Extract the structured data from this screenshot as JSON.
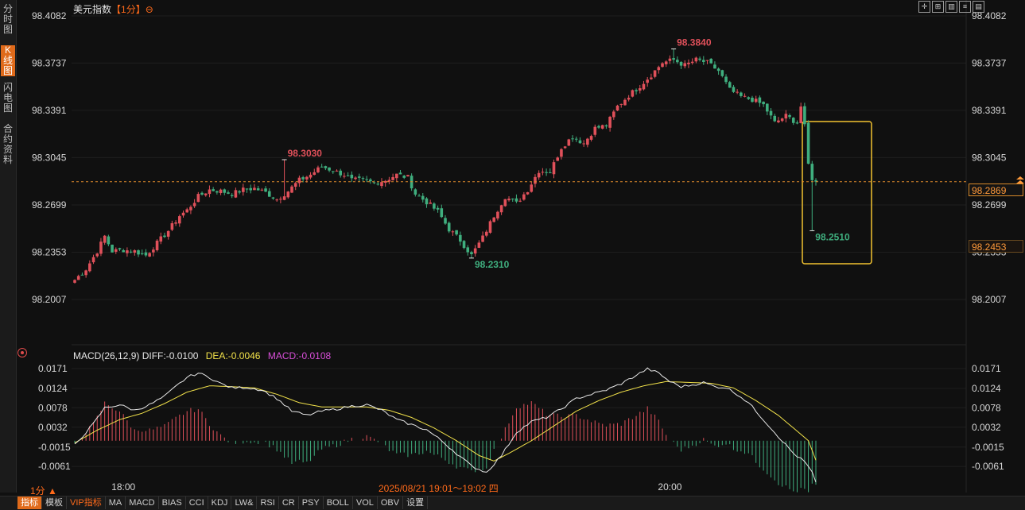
{
  "sidebar": {
    "tabs": [
      {
        "label": "分时图",
        "active": false
      },
      {
        "label": "K线图",
        "active": true
      },
      {
        "label": "闪电图",
        "active": false
      },
      {
        "label": "合约资料",
        "active": false
      }
    ]
  },
  "header": {
    "title": "美元指数",
    "period_label": "【1分】",
    "period_icon": "⊖",
    "toolbar_icons": [
      "grid-icon",
      "expand-icon",
      "bar-icon",
      "settings-icon",
      "layout-icon"
    ]
  },
  "macd_legend": {
    "params": "MACD(26,12,9)",
    "diff": "DIFF:-0.0100",
    "dea": "DEA:-0.0046",
    "macd": "MACD:-0.0108"
  },
  "footer": {
    "period_selector": "1分 ▲",
    "crosshair_time": "2025/08/21 19:01～19:02 四",
    "tabs": [
      {
        "label": "指标",
        "active": true
      },
      {
        "label": "模板"
      },
      {
        "label": "VIP指标",
        "vip": true
      },
      {
        "label": "MA"
      },
      {
        "label": "MACD"
      },
      {
        "label": "BIAS"
      },
      {
        "label": "CCI"
      },
      {
        "label": "KDJ"
      },
      {
        "label": "LW&"
      },
      {
        "label": "RSI"
      },
      {
        "label": "CR"
      },
      {
        "label": "PSY"
      },
      {
        "label": "BOLL"
      },
      {
        "label": "VOL"
      },
      {
        "label": "OBV"
      },
      {
        "label": "设置"
      }
    ]
  },
  "chart_data": [
    {
      "type": "candlestick",
      "title": "美元指数",
      "period": "1分",
      "y_ticks": [
        98.4082,
        98.3737,
        98.3391,
        98.3045,
        98.2699,
        98.2353,
        98.2007
      ],
      "ylim": [
        98.2007,
        98.4082
      ],
      "x_tick_labels": [
        "18:00",
        "20:00"
      ],
      "current_price_label": "98.2869",
      "current_price": 98.2869,
      "low_price_label": "98.2453",
      "annotations": [
        {
          "label": "98.3030",
          "value": 98.303,
          "kind": "local-high"
        },
        {
          "label": "98.3840",
          "value": 98.384,
          "kind": "session-high"
        },
        {
          "label": "98.2310",
          "value": 98.231,
          "kind": "local-low"
        },
        {
          "label": "98.2510",
          "value": 98.251,
          "kind": "recent-low"
        }
      ],
      "highlight_box": {
        "color": "#f2c230",
        "from_bar": 153,
        "to_bar": 163,
        "y_range": [
          98.23,
          98.33
        ]
      },
      "up_color": "#e0505a",
      "down_color": "#3fae7e",
      "close_path": [
        [
          0,
          98.215
        ],
        [
          3,
          98.223
        ],
        [
          6,
          98.236
        ],
        [
          8,
          98.247
        ],
        [
          10,
          98.236
        ],
        [
          13,
          98.237
        ],
        [
          16,
          98.236
        ],
        [
          19,
          98.233
        ],
        [
          22,
          98.242
        ],
        [
          25,
          98.251
        ],
        [
          28,
          98.262
        ],
        [
          30,
          98.266
        ],
        [
          33,
          98.276
        ],
        [
          36,
          98.281
        ],
        [
          39,
          98.28
        ],
        [
          42,
          98.278
        ],
        [
          45,
          98.281
        ],
        [
          48,
          98.282
        ],
        [
          51,
          98.279
        ],
        [
          54,
          98.274
        ],
        [
          57,
          98.28
        ],
        [
          60,
          98.288
        ],
        [
          63,
          98.292
        ],
        [
          66,
          98.298
        ],
        [
          69,
          98.295
        ],
        [
          72,
          98.292
        ],
        [
          74,
          98.288
        ],
        [
          77,
          98.288
        ],
        [
          80,
          98.286
        ],
        [
          83,
          98.288
        ],
        [
          86,
          98.292
        ],
        [
          89,
          98.29
        ],
        [
          91,
          98.278
        ],
        [
          94,
          98.272
        ],
        [
          97,
          98.265
        ],
        [
          100,
          98.252
        ],
        [
          103,
          98.244
        ],
        [
          106,
          98.233
        ],
        [
          109,
          98.246
        ],
        [
          112,
          98.262
        ],
        [
          115,
          98.276
        ],
        [
          118,
          98.271
        ],
        [
          121,
          98.281
        ],
        [
          124,
          98.295
        ],
        [
          127,
          98.294
        ],
        [
          130,
          98.312
        ],
        [
          133,
          98.32
        ],
        [
          136,
          98.315
        ],
        [
          139,
          98.326
        ],
        [
          142,
          98.328
        ],
        [
          145,
          98.342
        ],
        [
          148,
          98.35
        ],
        [
          151,
          98.357
        ],
        [
          154,
          98.365
        ],
        [
          157,
          98.374
        ],
        [
          160,
          98.376
        ],
        [
          163,
          98.372
        ],
        [
          166,
          98.376
        ],
        [
          169,
          98.374
        ],
        [
          172,
          98.368
        ],
        [
          175,
          98.354
        ],
        [
          178,
          98.349
        ],
        [
          181,
          98.347
        ],
        [
          184,
          98.343
        ],
        [
          187,
          98.33
        ],
        [
          190,
          98.335
        ],
        [
          193,
          98.33
        ],
        [
          194,
          98.342
        ],
        [
          195,
          98.327
        ],
        [
          196,
          98.3
        ],
        [
          197,
          98.288
        ],
        [
          198,
          98.2869
        ]
      ]
    },
    {
      "type": "macd",
      "params": "MACD(26,12,9)",
      "diff": -0.01,
      "dea": -0.0046,
      "macd": -0.0108,
      "y_ticks": [
        0.0171,
        0.0124,
        0.0078,
        0.0032,
        -0.0015,
        -0.0061
      ],
      "ylim": [
        -0.0085,
        0.0182
      ],
      "diff_color": "#e8e8e8",
      "dea_color": "#f2e24a",
      "hist_up_color": "#e0505a",
      "hist_down_color": "#3fae7e",
      "diff_path": [
        [
          0,
          -0.001
        ],
        [
          5,
          0.004
        ],
        [
          8,
          0.0078
        ],
        [
          12,
          0.0085
        ],
        [
          16,
          0.0072
        ],
        [
          20,
          0.0085
        ],
        [
          24,
          0.0105
        ],
        [
          27,
          0.0128
        ],
        [
          30,
          0.015
        ],
        [
          33,
          0.016
        ],
        [
          36,
          0.015
        ],
        [
          39,
          0.0135
        ],
        [
          42,
          0.0125
        ],
        [
          46,
          0.0126
        ],
        [
          50,
          0.012
        ],
        [
          54,
          0.01
        ],
        [
          58,
          0.007
        ],
        [
          62,
          0.006
        ],
        [
          66,
          0.007
        ],
        [
          70,
          0.0075
        ],
        [
          74,
          0.0082
        ],
        [
          78,
          0.0085
        ],
        [
          82,
          0.0072
        ],
        [
          86,
          0.005
        ],
        [
          90,
          0.0038
        ],
        [
          94,
          0.0026
        ],
        [
          98,
          0.0
        ],
        [
          102,
          -0.003
        ],
        [
          106,
          -0.006
        ],
        [
          110,
          -0.0075
        ],
        [
          114,
          -0.0035
        ],
        [
          118,
          0.002
        ],
        [
          122,
          0.0045
        ],
        [
          126,
          0.0055
        ],
        [
          130,
          0.0075
        ],
        [
          134,
          0.01
        ],
        [
          138,
          0.011
        ],
        [
          142,
          0.012
        ],
        [
          146,
          0.0135
        ],
        [
          150,
          0.0155
        ],
        [
          153,
          0.017
        ],
        [
          156,
          0.016
        ],
        [
          159,
          0.014
        ],
        [
          162,
          0.0128
        ],
        [
          165,
          0.0132
        ],
        [
          168,
          0.0138
        ],
        [
          171,
          0.0128
        ],
        [
          174,
          0.0126
        ],
        [
          177,
          0.011
        ],
        [
          180,
          0.009
        ],
        [
          183,
          0.006
        ],
        [
          186,
          0.003
        ],
        [
          189,
          0.0
        ],
        [
          192,
          -0.003
        ],
        [
          195,
          -0.005
        ],
        [
          197,
          -0.0075
        ],
        [
          198,
          -0.01
        ]
      ],
      "dea_path": [
        [
          0,
          -0.0005
        ],
        [
          6,
          0.0025
        ],
        [
          12,
          0.005
        ],
        [
          18,
          0.0065
        ],
        [
          24,
          0.0088
        ],
        [
          30,
          0.0115
        ],
        [
          36,
          0.013
        ],
        [
          42,
          0.0128
        ],
        [
          48,
          0.0125
        ],
        [
          54,
          0.011
        ],
        [
          60,
          0.009
        ],
        [
          66,
          0.008
        ],
        [
          72,
          0.008
        ],
        [
          78,
          0.008
        ],
        [
          84,
          0.0072
        ],
        [
          90,
          0.0055
        ],
        [
          96,
          0.003
        ],
        [
          102,
          0.0
        ],
        [
          108,
          -0.0035
        ],
        [
          112,
          -0.0048
        ],
        [
          116,
          -0.003
        ],
        [
          122,
          0.0
        ],
        [
          128,
          0.0035
        ],
        [
          134,
          0.007
        ],
        [
          140,
          0.0095
        ],
        [
          146,
          0.0115
        ],
        [
          152,
          0.013
        ],
        [
          158,
          0.014
        ],
        [
          164,
          0.0138
        ],
        [
          170,
          0.0136
        ],
        [
          176,
          0.0125
        ],
        [
          182,
          0.0095
        ],
        [
          188,
          0.006
        ],
        [
          192,
          0.003
        ],
        [
          196,
          0.0
        ],
        [
          198,
          -0.0046
        ]
      ]
    }
  ]
}
